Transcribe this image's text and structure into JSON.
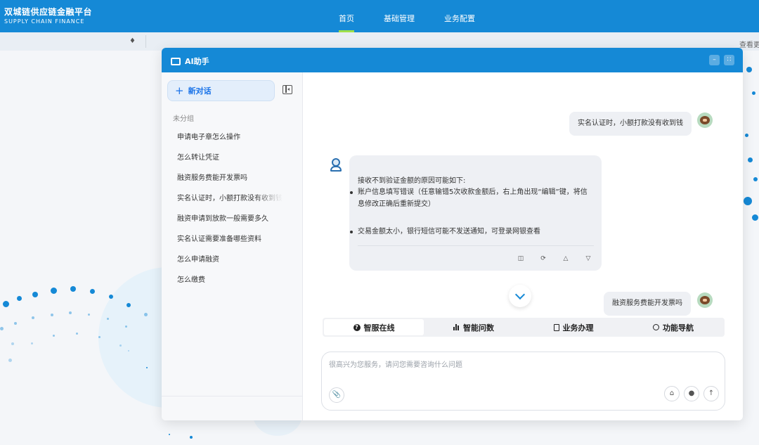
{
  "app": {
    "title": "双城链供应链金融平台",
    "subtitle": "SUPPLY CHAIN FINANCE",
    "accent_color": "#1589d6",
    "nav": [
      {
        "label": "首页",
        "active": true
      },
      {
        "label": "基础管理",
        "active": false
      },
      {
        "label": "业务配置",
        "active": false
      }
    ],
    "subbar": {
      "view_more": "查看更"
    }
  },
  "assistant": {
    "title": "AI助手",
    "header_icon": "chat-icon",
    "controls": [
      "minimize-icon",
      "expand-icon"
    ],
    "sidebar": {
      "new_chat_label": "新对话",
      "collapse_icon": "sidebar-collapse-icon",
      "group_label": "未分组",
      "conversations": [
        "申请电子章怎么操作",
        "怎么转让凭证",
        "融资服务费能开发票吗",
        "实名认证时，小额打款没有收到钱",
        "融资申请到放款一般需要多久",
        "实名认证需要准备哪些资料",
        "怎么申请融资",
        "怎么缴费"
      ]
    },
    "messages": {
      "user_1": "实名认证时，小额打款没有收到钱",
      "bot_intro": "接收不到验证金额的原因可能如下:",
      "bot_points": [
        "账户信息填写错误（任意输错5次收款金额后，右上角出现“编辑”键，将信息修改正确后重新提交）",
        "交易金额太小，银行短信可能不发送通知，可登录网银查看"
      ],
      "bot_actions": [
        "copy-icon",
        "regenerate-icon",
        "thumbs-up-icon",
        "thumbs-down-icon"
      ],
      "user_2": "融资服务费能开发票吗"
    },
    "tabs": [
      {
        "label": "智服在线",
        "icon": "help-circle-icon",
        "active": true
      },
      {
        "label": "智能问数",
        "icon": "bar-chart-icon",
        "active": false
      },
      {
        "label": "业务办理",
        "icon": "document-icon",
        "active": false
      },
      {
        "label": "功能导航",
        "icon": "search-icon",
        "active": false
      }
    ],
    "input": {
      "placeholder": "很高兴为您服务，请问您需要咨询什么问题",
      "value": ""
    }
  }
}
